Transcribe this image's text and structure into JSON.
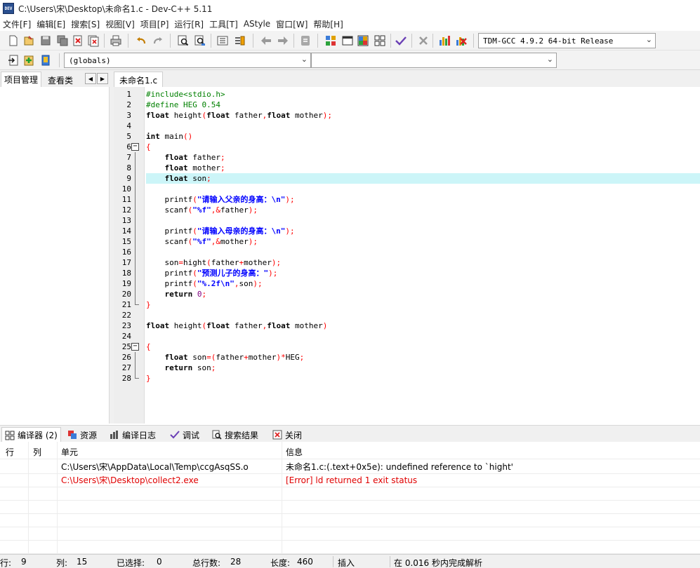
{
  "window": {
    "title": "C:\\Users\\宋\\Desktop\\未命名1.c - Dev-C++ 5.11",
    "icon_text": "DEV"
  },
  "menu": [
    "文件[F]",
    "编辑[E]",
    "搜索[S]",
    "视图[V]",
    "项目[P]",
    "运行[R]",
    "工具[T]",
    "AStyle",
    "窗口[W]",
    "帮助[H]"
  ],
  "toolbar": {
    "compiler_select": "TDM-GCC 4.9.2 64-bit Release",
    "scope_select": "(globals)",
    "symbol_select": ""
  },
  "left_panel": {
    "tabs": [
      "项目管理",
      "查看类"
    ]
  },
  "editor": {
    "tab_label": "未命名1.c",
    "current_line": 9
  },
  "code_lines": [
    [
      [
        "pp",
        "#include<stdio.h>"
      ]
    ],
    [
      [
        "pp",
        "#define HEG 0.54"
      ]
    ],
    [
      [
        "kw",
        "float"
      ],
      [
        "txt",
        " height"
      ],
      [
        "sym",
        "("
      ],
      [
        "kw",
        "float"
      ],
      [
        "txt",
        " father"
      ],
      [
        "sym",
        ","
      ],
      [
        "kw",
        "float"
      ],
      [
        "txt",
        " mother"
      ],
      [
        "sym",
        ");"
      ]
    ],
    [],
    [
      [
        "kw",
        "int"
      ],
      [
        "txt",
        " main"
      ],
      [
        "sym",
        "()"
      ]
    ],
    [
      [
        "sym",
        "{"
      ]
    ],
    [
      [
        "txt",
        "    "
      ],
      [
        "kw",
        "float"
      ],
      [
        "txt",
        " father"
      ],
      [
        "sym",
        ";"
      ]
    ],
    [
      [
        "txt",
        "    "
      ],
      [
        "kw",
        "float"
      ],
      [
        "txt",
        " mother"
      ],
      [
        "sym",
        ";"
      ]
    ],
    [
      [
        "txt",
        "    "
      ],
      [
        "kw",
        "float"
      ],
      [
        "txt",
        " son"
      ],
      [
        "sym",
        ";"
      ]
    ],
    [],
    [
      [
        "txt",
        "    printf"
      ],
      [
        "sym",
        "("
      ],
      [
        "str",
        "\"请输入父亲的身高：\\n\""
      ],
      [
        "sym",
        ");"
      ]
    ],
    [
      [
        "txt",
        "    scanf"
      ],
      [
        "sym",
        "("
      ],
      [
        "str",
        "\"%f\""
      ],
      [
        "sym",
        ",&"
      ],
      [
        "txt",
        "father"
      ],
      [
        "sym",
        ");"
      ]
    ],
    [],
    [
      [
        "txt",
        "    printf"
      ],
      [
        "sym",
        "("
      ],
      [
        "str",
        "\"请输入母亲的身高：\\n\""
      ],
      [
        "sym",
        ");"
      ]
    ],
    [
      [
        "txt",
        "    scanf"
      ],
      [
        "sym",
        "("
      ],
      [
        "str",
        "\"%f\""
      ],
      [
        "sym",
        ",&"
      ],
      [
        "txt",
        "mother"
      ],
      [
        "sym",
        ");"
      ]
    ],
    [],
    [
      [
        "txt",
        "    son"
      ],
      [
        "sym",
        "="
      ],
      [
        "txt",
        "hight"
      ],
      [
        "sym",
        "("
      ],
      [
        "txt",
        "father"
      ],
      [
        "sym",
        "+"
      ],
      [
        "txt",
        "mother"
      ],
      [
        "sym",
        ");"
      ]
    ],
    [
      [
        "txt",
        "    printf"
      ],
      [
        "sym",
        "("
      ],
      [
        "str",
        "\"预测儿子的身高：\""
      ],
      [
        "sym",
        ");"
      ]
    ],
    [
      [
        "txt",
        "    printf"
      ],
      [
        "sym",
        "("
      ],
      [
        "str",
        "\"%.2f\\n\""
      ],
      [
        "sym",
        ","
      ],
      [
        "txt",
        "son"
      ],
      [
        "sym",
        ");"
      ]
    ],
    [
      [
        "txt",
        "    "
      ],
      [
        "kw",
        "return"
      ],
      [
        "txt",
        " "
      ],
      [
        "num",
        "0"
      ],
      [
        "sym",
        ";"
      ]
    ],
    [
      [
        "sym",
        "}"
      ]
    ],
    [],
    [
      [
        "kw",
        "float"
      ],
      [
        "txt",
        " height"
      ],
      [
        "sym",
        "("
      ],
      [
        "kw",
        "float"
      ],
      [
        "txt",
        " father"
      ],
      [
        "sym",
        ","
      ],
      [
        "kw",
        "float"
      ],
      [
        "txt",
        " mother"
      ],
      [
        "sym",
        ")"
      ]
    ],
    [],
    [
      [
        "sym",
        "{"
      ]
    ],
    [
      [
        "txt",
        "    "
      ],
      [
        "kw",
        "float"
      ],
      [
        "txt",
        " son"
      ],
      [
        "sym",
        "=("
      ],
      [
        "txt",
        "father"
      ],
      [
        "sym",
        "+"
      ],
      [
        "txt",
        "mother"
      ],
      [
        "sym",
        ")*"
      ],
      [
        "txt",
        "HEG"
      ],
      [
        "sym",
        ";"
      ]
    ],
    [
      [
        "txt",
        "    "
      ],
      [
        "kw",
        "return"
      ],
      [
        "txt",
        " son"
      ],
      [
        "sym",
        ";"
      ]
    ],
    [
      [
        "sym",
        "}"
      ]
    ]
  ],
  "bottom_tabs": [
    "编译器 (2)",
    "资源",
    "编译日志",
    "调试",
    "搜索结果",
    "关闭"
  ],
  "messages": {
    "headers": [
      "行",
      "列",
      "单元",
      "信息"
    ],
    "rows": [
      {
        "line": "",
        "col": "",
        "unit": "C:\\Users\\宋\\AppData\\Local\\Temp\\ccgAsqSS.o",
        "message": "未命名1.c:(.text+0x5e): undefined reference to `hight'",
        "error": false
      },
      {
        "line": "",
        "col": "",
        "unit": "C:\\Users\\宋\\Desktop\\collect2.exe",
        "message": "[Error] ld returned 1 exit status",
        "error": true
      }
    ]
  },
  "status": {
    "line_label": "行:",
    "line_value": "9",
    "col_label": "列:",
    "col_value": "15",
    "sel_label": "已选择:",
    "sel_value": "0",
    "total_label": "总行数:",
    "total_value": "28",
    "len_label": "长度:",
    "len_value": "460",
    "mode": "插入",
    "parse_info": "在 0.016 秒内完成解析"
  }
}
